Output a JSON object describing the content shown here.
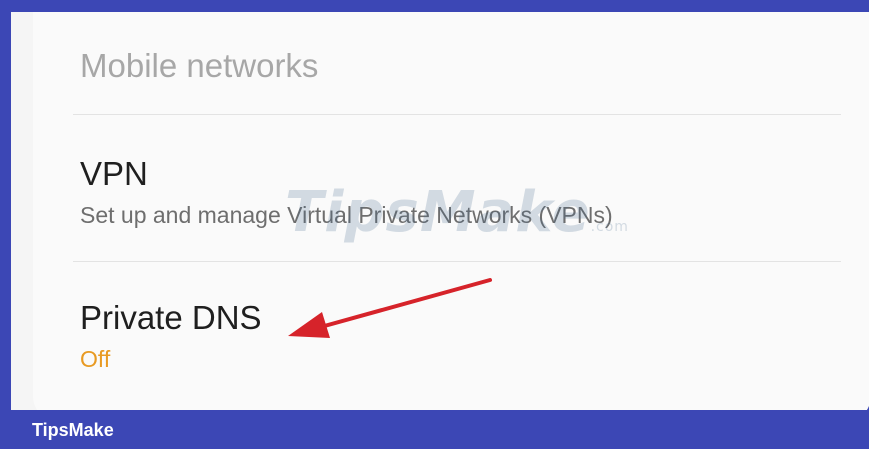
{
  "settings": {
    "items": [
      {
        "title": "Mobile networks"
      },
      {
        "title": "VPN",
        "subtitle": "Set up and manage Virtual Private Networks (VPNs)"
      },
      {
        "title": "Private DNS",
        "status": "Off"
      }
    ]
  },
  "watermark": {
    "main": "TipsMake",
    "suffix": ".com"
  },
  "footer": {
    "label": "TipsMake"
  },
  "colors": {
    "status_off": "#e89a22",
    "frame": "#3c47b5",
    "arrow": "#d6232a"
  }
}
